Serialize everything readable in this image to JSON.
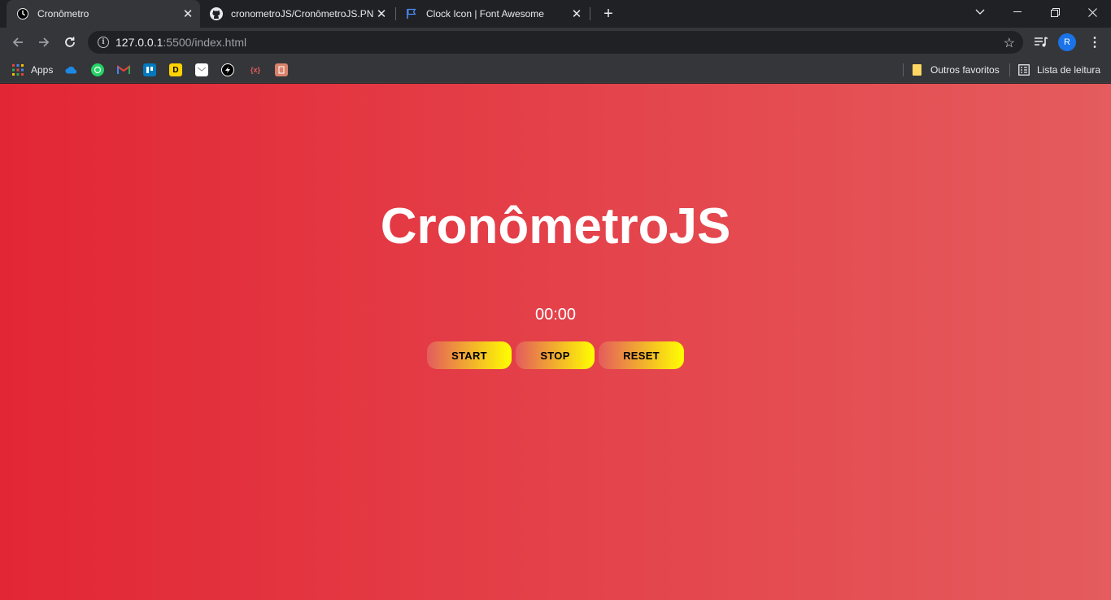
{
  "browser": {
    "tabs": [
      {
        "title": "Cronômetro",
        "favicon": "clock-icon",
        "active": true
      },
      {
        "title": "cronometroJS/CronômetroJS.PNG",
        "favicon": "github-icon",
        "active": false
      },
      {
        "title": "Clock Icon | Font Awesome",
        "favicon": "flag-icon",
        "active": false
      }
    ],
    "address_bar": {
      "host": "127.0.0.1",
      "path": ":5500/index.html"
    },
    "profile_initial": "R",
    "bookmarks": {
      "apps_label": "Apps",
      "other_favorites": "Outros favoritos",
      "reading_list": "Lista de leitura"
    }
  },
  "app": {
    "title": "CronômetroJS",
    "time": "00:00",
    "buttons": {
      "start": "START",
      "stop": "STOP",
      "reset": "RESET"
    }
  },
  "colors": {
    "gradient_start": "#e32636",
    "gradient_end": "#e45c5d",
    "button_gradient_start": "#e45c5d",
    "button_gradient_end": "#ffff00"
  }
}
